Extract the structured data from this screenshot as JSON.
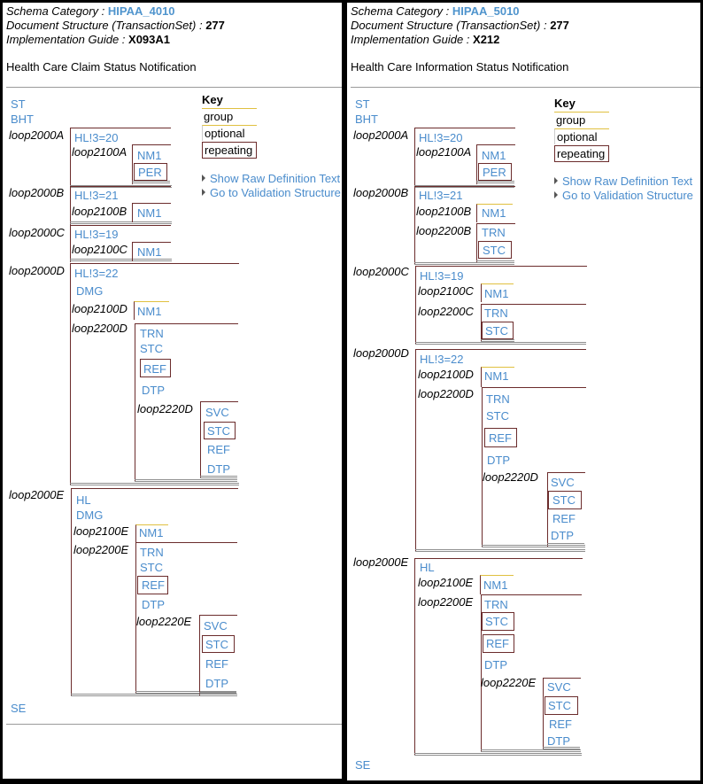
{
  "left": {
    "schema_label": "Schema Category : ",
    "schema_value": "HIPAA_4010",
    "doc_label": "Document Structure (TransactionSet) : ",
    "doc_value": "277",
    "guide_label": "Implementation Guide : ",
    "guide_value": "X093A1",
    "title": "Health Care Claim Status Notification",
    "key_title": "Key",
    "key_group": "group",
    "key_optional": "optional",
    "key_repeating": "repeating",
    "link_raw": "Show Raw Definition Text",
    "link_validation": "Go to Validation Structure",
    "seg_st": "ST",
    "seg_bht": "BHT",
    "seg_se": "SE",
    "loop2000A": "loop2000A",
    "hl20": "HL!3=20",
    "loop2100A": "loop2100A",
    "nm1_a": "NM1",
    "per_a": "PER",
    "loop2000B": "loop2000B",
    "hl21": "HL!3=21",
    "loop2100B": "loop2100B",
    "nm1_b": "NM1",
    "loop2000C": "loop2000C",
    "hl19": "HL!3=19",
    "loop2100C": "loop2100C",
    "nm1_c": "NM1",
    "loop2000D": "loop2000D",
    "hl22": "HL!3=22",
    "dmg_d": "DMG",
    "loop2100D": "loop2100D",
    "nm1_d": "NM1",
    "loop2200D": "loop2200D",
    "trn_d": "TRN",
    "stc_d": "STC",
    "ref_d": "REF",
    "dtp_d": "DTP",
    "loop2220D": "loop2220D",
    "svc_dd": "SVC",
    "stc_dd": "STC",
    "ref_dd": "REF",
    "dtp_dd": "DTP",
    "loop2000E": "loop2000E",
    "hl_e": "HL",
    "dmg_e": "DMG",
    "loop2100E": "loop2100E",
    "nm1_e": "NM1",
    "loop2200E": "loop2200E",
    "trn_e": "TRN",
    "stc_e": "STC",
    "ref_e": "REF",
    "dtp_e": "DTP",
    "loop2220E": "loop2220E",
    "svc_ee": "SVC",
    "stc_ee": "STC",
    "ref_ee": "REF",
    "dtp_ee": "DTP"
  },
  "right": {
    "schema_label": "Schema Category : ",
    "schema_value": "HIPAA_5010",
    "doc_label": "Document Structure (TransactionSet) : ",
    "doc_value": "277",
    "guide_label": "Implementation Guide : ",
    "guide_value": "X212",
    "title": "Health Care Information Status Notification",
    "key_title": "Key",
    "key_group": "group",
    "key_optional": "optional",
    "key_repeating": "repeating",
    "link_raw": "Show Raw Definition Text",
    "link_validation": "Go to Validation Structure",
    "seg_st": "ST",
    "seg_bht": "BHT",
    "seg_se": "SE",
    "loop2000A": "loop2000A",
    "hl20": "HL!3=20",
    "loop2100A": "loop2100A",
    "nm1_a": "NM1",
    "per_a": "PER",
    "loop2000B": "loop2000B",
    "hl21": "HL!3=21",
    "loop2100B": "loop2100B",
    "nm1_b": "NM1",
    "loop2200B": "loop2200B",
    "trn_b": "TRN",
    "stc_b": "STC",
    "loop2000C": "loop2000C",
    "hl19": "HL!3=19",
    "loop2100C": "loop2100C",
    "nm1_c": "NM1",
    "loop2200C": "loop2200C",
    "trn_c": "TRN",
    "stc_c": "STC",
    "loop2000D": "loop2000D",
    "hl22": "HL!3=22",
    "loop2100D": "loop2100D",
    "nm1_d": "NM1",
    "loop2200D": "loop2200D",
    "trn_d": "TRN",
    "stc_d": "STC",
    "ref_d": "REF",
    "dtp_d": "DTP",
    "loop2220D": "loop2220D",
    "svc_dd": "SVC",
    "stc_dd": "STC",
    "ref_dd": "REF",
    "dtp_dd": "DTP",
    "loop2000E": "loop2000E",
    "hl_e": "HL",
    "loop2100E": "loop2100E",
    "nm1_e": "NM1",
    "loop2200E": "loop2200E",
    "trn_e": "TRN",
    "stc_e": "STC",
    "ref_e": "REF",
    "dtp_e": "DTP",
    "loop2220E": "loop2220E",
    "svc_ee": "SVC",
    "stc_ee": "STC",
    "ref_ee": "REF",
    "dtp_ee": "DTP"
  }
}
